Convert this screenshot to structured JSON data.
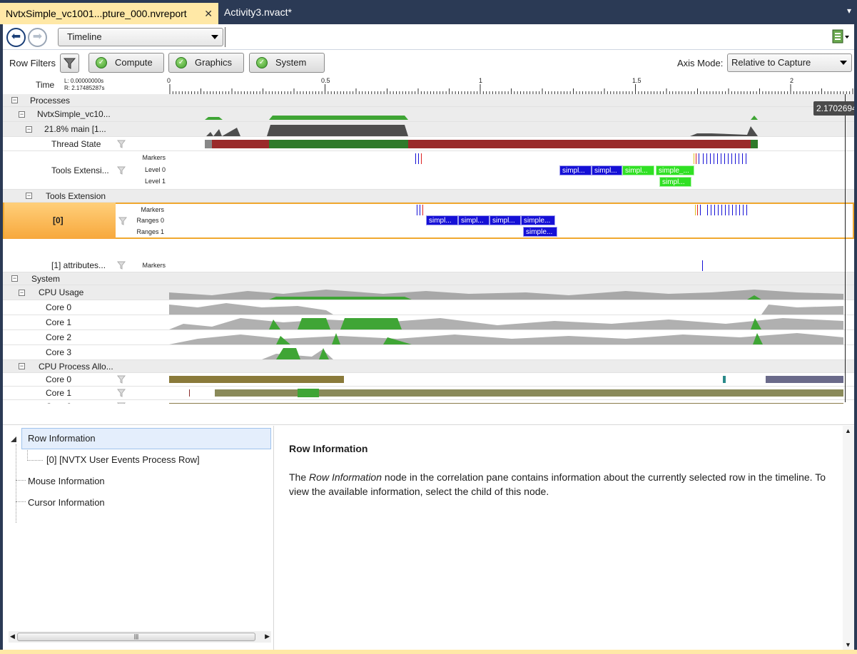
{
  "tabs": [
    {
      "label": "NvtxSimple_vc1001...pture_000.nvreport",
      "active": true
    },
    {
      "label": "Activity3.nvact*",
      "active": false
    }
  ],
  "toolbar": {
    "view": "Timeline"
  },
  "filters": {
    "label": "Row Filters",
    "buttons": [
      "Compute",
      "Graphics",
      "System"
    ],
    "axis_label": "Axis Mode:",
    "axis_value": "Relative to Capture"
  },
  "ruler": {
    "label": "Time",
    "left": "L: 0.00000000s",
    "right": "R: 2.17485287s",
    "ticks": [
      "0",
      "0.5",
      "1",
      "1.5",
      "2"
    ],
    "cursor": "2.17026940"
  },
  "rows": {
    "processes": "Processes",
    "process": "NvtxSimple_vc10...",
    "thread": "21.8% main [1...",
    "thread_state": "Thread State",
    "tools_ext_row": "Tools Extensi...",
    "tools_extension": "Tools Extension",
    "idx0": "[0]",
    "idx1": "[1]  attributes...",
    "system": "System",
    "cpu_usage": "CPU Usage",
    "cpu_alloc": "CPU Process Allo...",
    "cores": [
      "Core 0",
      "Core 1",
      "Core 2",
      "Core 3"
    ]
  },
  "sublabels": {
    "markers": "Markers",
    "level0": "Level 0",
    "level1": "Level 1",
    "ranges0": "Ranges 0",
    "ranges1": "Ranges 1"
  },
  "segments": {
    "level0": [
      "simpl...",
      "simpl...",
      "simpl...",
      "simple_..."
    ],
    "level1": [
      "simpl..."
    ],
    "ranges0": [
      "simpl...",
      "simpl...",
      "simpl...",
      "simple..."
    ],
    "ranges1": [
      "simple..."
    ]
  },
  "tree": {
    "items": [
      "Row Information",
      "[0] [NVTX User Events Process Row]",
      "Mouse Information",
      "Cursor Information"
    ]
  },
  "info": {
    "title": "Row Information",
    "body_pre": "The ",
    "body_em": "Row Information",
    "body_post": " node in the correlation pane contains information about the currently selected row in the timeline. To view the available information, select the child of this node."
  },
  "colors": {
    "accent": "#ffe8a6",
    "chrome": "#2b3a55",
    "range_blue": "#1510d6",
    "range_green": "#30e024",
    "thread_red": "#9a2a2a",
    "thread_green": "#2f7a2a"
  },
  "icons": [
    "back-arrow-icon",
    "forward-arrow-icon",
    "export-icon",
    "filter-icon",
    "check-icon",
    "close-icon"
  ]
}
